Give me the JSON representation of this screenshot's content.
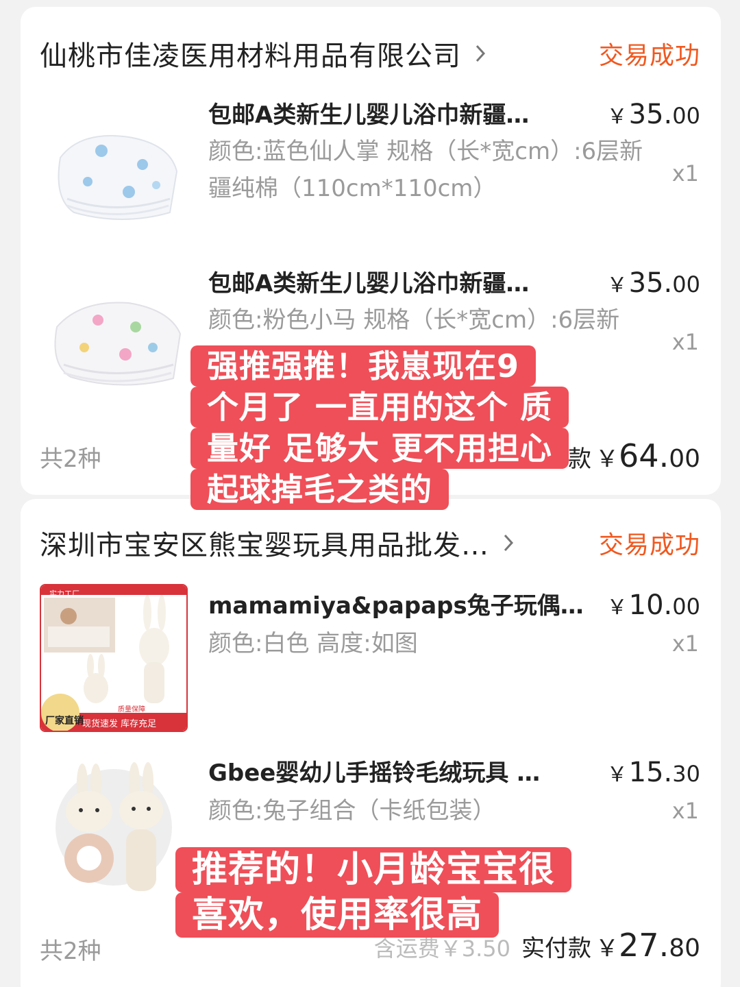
{
  "orders": [
    {
      "shop_name": "仙桃市佳凌医用材料用品有限公司",
      "status": "交易成功",
      "items": [
        {
          "title": "包邮A类新生儿婴儿浴巾新疆…",
          "spec": "颜色:蓝色仙人掌 规格（长*宽cm）:6层新疆纯棉（110cm*110cm）",
          "price_int": "35.",
          "price_dec": "00",
          "qty": "x1",
          "thumb_icon": "blanket-thumbnail-blue"
        },
        {
          "title": "包邮A类新生儿婴儿浴巾新疆…",
          "spec": "颜色:粉色小马 规格（长*宽cm）:6层新",
          "price_int": "35.",
          "price_dec": "00",
          "qty": "x1",
          "thumb_icon": "blanket-thumbnail-pink"
        }
      ],
      "count_label": "共2种",
      "pay_label": "实付款",
      "pay_int": "64.",
      "pay_dec": "00"
    },
    {
      "shop_name": "深圳市宝安区熊宝婴玩具用品批发…",
      "status": "交易成功",
      "items": [
        {
          "title": "mamamiya&papaps兔子玩偶…",
          "spec": "颜色:白色 高度:如图",
          "price_int": "10.",
          "price_dec": "00",
          "qty": "x1",
          "thumb_icon": "bunny-doll-thumbnail",
          "thumb_badges": {
            "factory": "实力工厂",
            "direct": "厂家直销",
            "quality": "质量保障",
            "stock": "现货速发 库存充足"
          }
        },
        {
          "title": "Gbee婴幼儿手摇铃毛绒玩具 …",
          "spec": "颜色:兔子组合（卡纸包装）",
          "price_int": "15.",
          "price_dec": "30",
          "qty": "x1",
          "thumb_icon": "bunny-rattle-thumbnail"
        }
      ],
      "count_label": "共2种",
      "freight_label": "含运费￥3.50",
      "pay_label": "实付款",
      "pay_int": "27.",
      "pay_dec": "80"
    }
  ],
  "currency": "￥",
  "overlay_comments": [
    {
      "lines": [
        "强推强推！我崽现在9",
        "个月了 一直用的这个 质",
        "量好 足够大 更不用担心",
        "起球掉毛之类的"
      ]
    },
    {
      "lines": [
        "推荐的！小月龄宝宝很",
        "喜欢，使用率很高"
      ]
    }
  ],
  "colors": {
    "status": "#f0581f",
    "comment_bg": "#ef4f58",
    "muted": "#9a9a9a"
  }
}
